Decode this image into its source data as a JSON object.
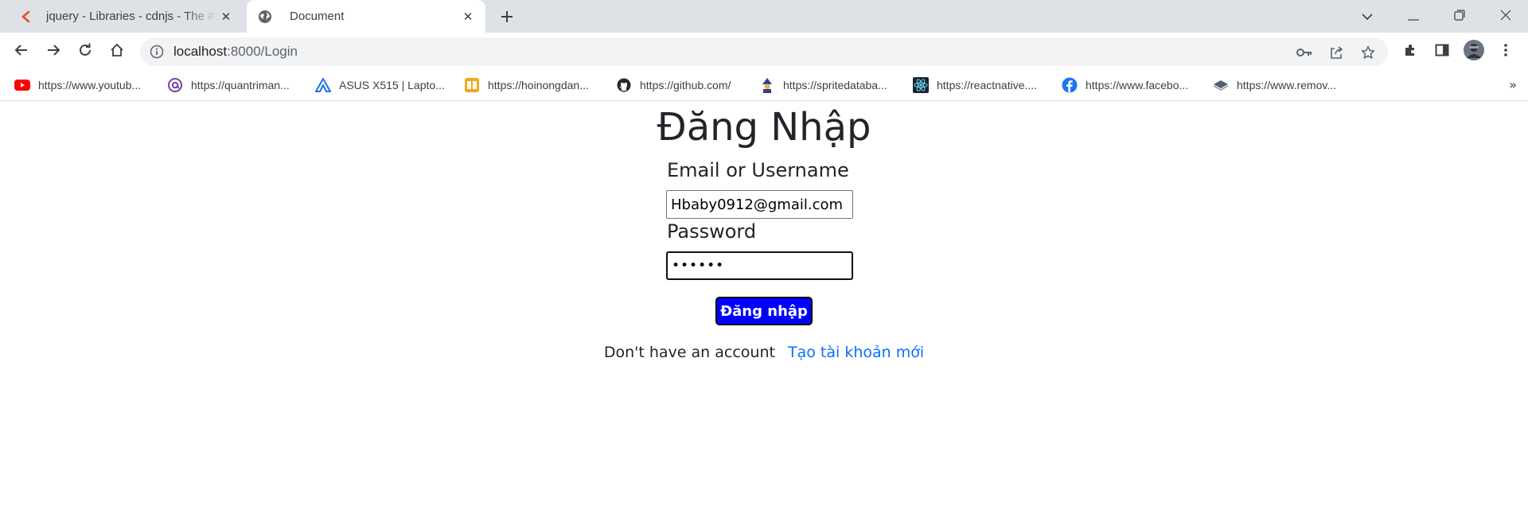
{
  "browser": {
    "tabs": [
      {
        "title": "jquery - Libraries - cdnjs - The #1",
        "favicon": "cdnjs-icon",
        "active": false
      },
      {
        "title": "Document",
        "favicon": "globe-icon",
        "active": true
      }
    ],
    "address": {
      "host": "localhost",
      "path": ":8000/Login"
    },
    "bookmarks": [
      {
        "label": "https://www.youtub...",
        "icon": "youtube-icon"
      },
      {
        "label": "https://quantriman...",
        "icon": "at-icon"
      },
      {
        "label": "ASUS X515 | Lapto...",
        "icon": "asus-icon"
      },
      {
        "label": "https://hoinongdan...",
        "icon": "hoinongdan-icon"
      },
      {
        "label": "https://github.com/",
        "icon": "github-icon"
      },
      {
        "label": "https://spritedataba...",
        "icon": "sprite-icon"
      },
      {
        "label": "https://reactnative....",
        "icon": "react-icon"
      },
      {
        "label": "https://www.facebo...",
        "icon": "facebook-icon"
      },
      {
        "label": "https://www.remov...",
        "icon": "remove-bg-icon"
      }
    ],
    "bookmarks_overflow": "»"
  },
  "login": {
    "heading": "Đăng Nhập",
    "email_label": "Email or Username",
    "email_value": "Hbaby0912@gmail.com",
    "password_label": "Password",
    "password_value": "••••••",
    "submit_label": "Đăng nhập",
    "no_account_text": "Don't have an account",
    "signup_link": "Tạo tài khoản mới"
  },
  "colors": {
    "submit_bg": "#0000ff",
    "link": "#0d6efd",
    "text": "#212529"
  }
}
